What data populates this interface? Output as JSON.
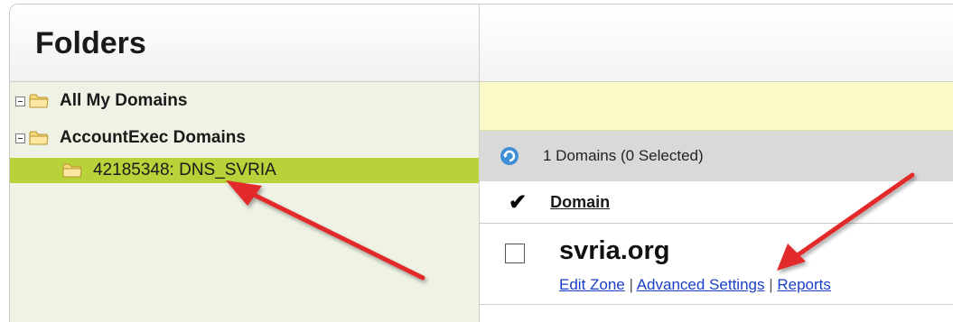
{
  "folders_panel": {
    "title": "Folders",
    "tree": [
      {
        "label": "All My Domains"
      },
      {
        "label": "AccountExec Domains"
      },
      {
        "label": "42185348: DNS_SVRIA"
      }
    ]
  },
  "domains_panel": {
    "status_text": "1 Domains (0 Selected)",
    "column_header": "Domain",
    "rows": [
      {
        "name": "svria.org",
        "links": [
          "Edit Zone",
          "Advanced Settings",
          "Reports"
        ],
        "separator": "|"
      }
    ]
  },
  "colors": {
    "selected_row": "#b8d23a",
    "tree_background": "#eef3e5",
    "notice_background": "#fbf9c8",
    "status_bar": "#d9d9d9",
    "link": "#1a3fc7",
    "annotation_arrow": "#e32b2b"
  }
}
